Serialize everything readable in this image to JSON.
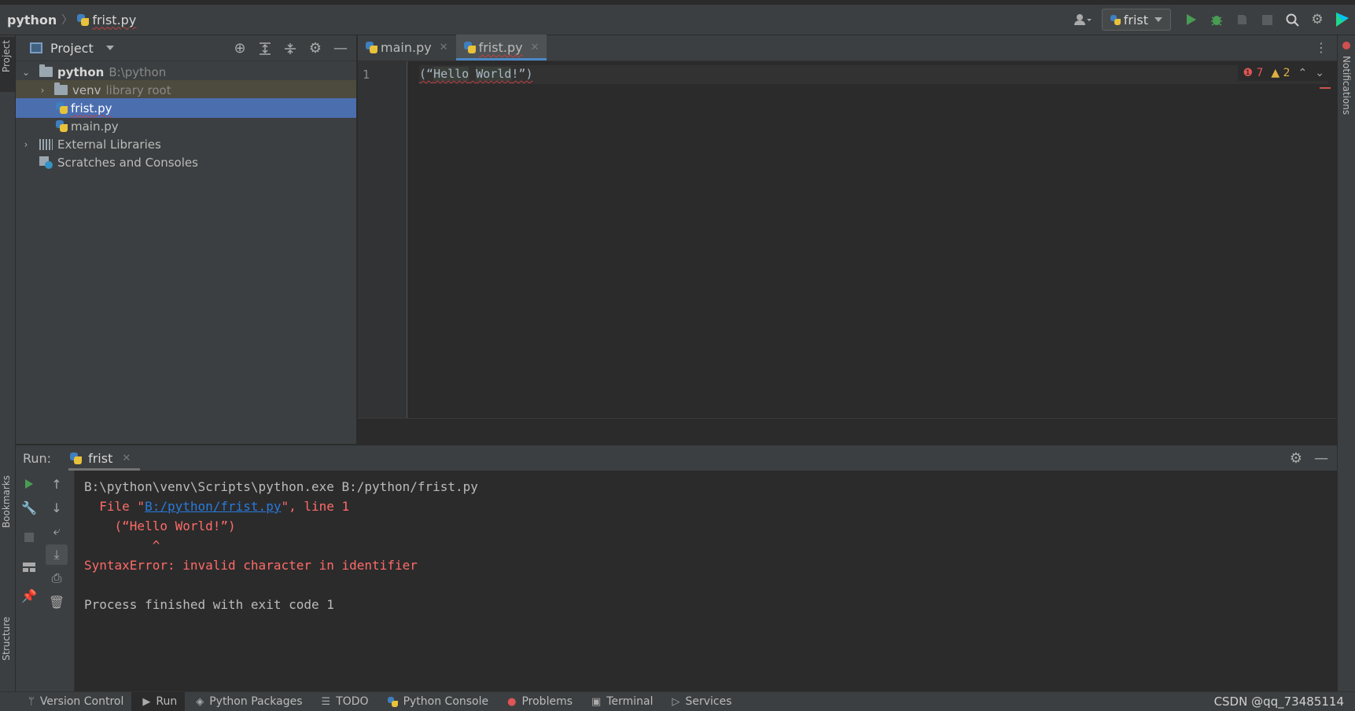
{
  "titlebar": {
    "project_name": "python",
    "file_name": "frist.py",
    "run_config": "frist"
  },
  "left_stripe": {
    "project_tab": "Project",
    "bookmarks_tab": "Bookmarks",
    "structure_tab": "Structure"
  },
  "right_stripe": {
    "notifications_tab": "Notifications"
  },
  "project_panel": {
    "title": "Project",
    "tree": [
      {
        "label": "python",
        "hint": "B:\\python"
      },
      {
        "label": "venv",
        "hint": "library root"
      },
      {
        "label": "frist.py"
      },
      {
        "label": "main.py"
      },
      {
        "label": "External Libraries"
      },
      {
        "label": "Scratches and Consoles"
      }
    ]
  },
  "editor": {
    "tabs": [
      {
        "label": "main.py",
        "active": false
      },
      {
        "label": "frist.py",
        "active": true
      }
    ],
    "line_number": "1",
    "code_open": "(“",
    "code_word1": "Hello",
    "code_space": " ",
    "code_word2": "World",
    "code_close": "!”)",
    "error_count": "7",
    "warning_count": "2"
  },
  "run_panel": {
    "label": "Run:",
    "tab": "frist",
    "console": {
      "command": "B:\\python\\venv\\Scripts\\python.exe B:/python/frist.py",
      "file_prefix": "  File \"",
      "file_link": "B:/python/frist.py",
      "file_suffix": "\", line 1",
      "code_echo": "    (“Hello World!”)",
      "caret": "         ^",
      "error": "SyntaxError: invalid character in identifier",
      "exit": "Process finished with exit code 1"
    }
  },
  "bottom_bar": {
    "items": [
      {
        "label": "Version Control",
        "icon": "branch-icon"
      },
      {
        "label": "Run",
        "icon": "play-icon"
      },
      {
        "label": "Python Packages",
        "icon": "layers-icon"
      },
      {
        "label": "TODO",
        "icon": "list-icon"
      },
      {
        "label": "Python Console",
        "icon": "python-icon"
      },
      {
        "label": "Problems",
        "icon": "error-icon"
      },
      {
        "label": "Terminal",
        "icon": "terminal-icon"
      },
      {
        "label": "Services",
        "icon": "services-icon"
      }
    ],
    "watermark": "CSDN @qq_73485114"
  },
  "colors": {
    "background": "#2b2b2b",
    "panel": "#3c3f41",
    "selection": "#4b6eaf",
    "error": "#ff6b68",
    "run_green": "#499c54",
    "link": "#287bde"
  }
}
